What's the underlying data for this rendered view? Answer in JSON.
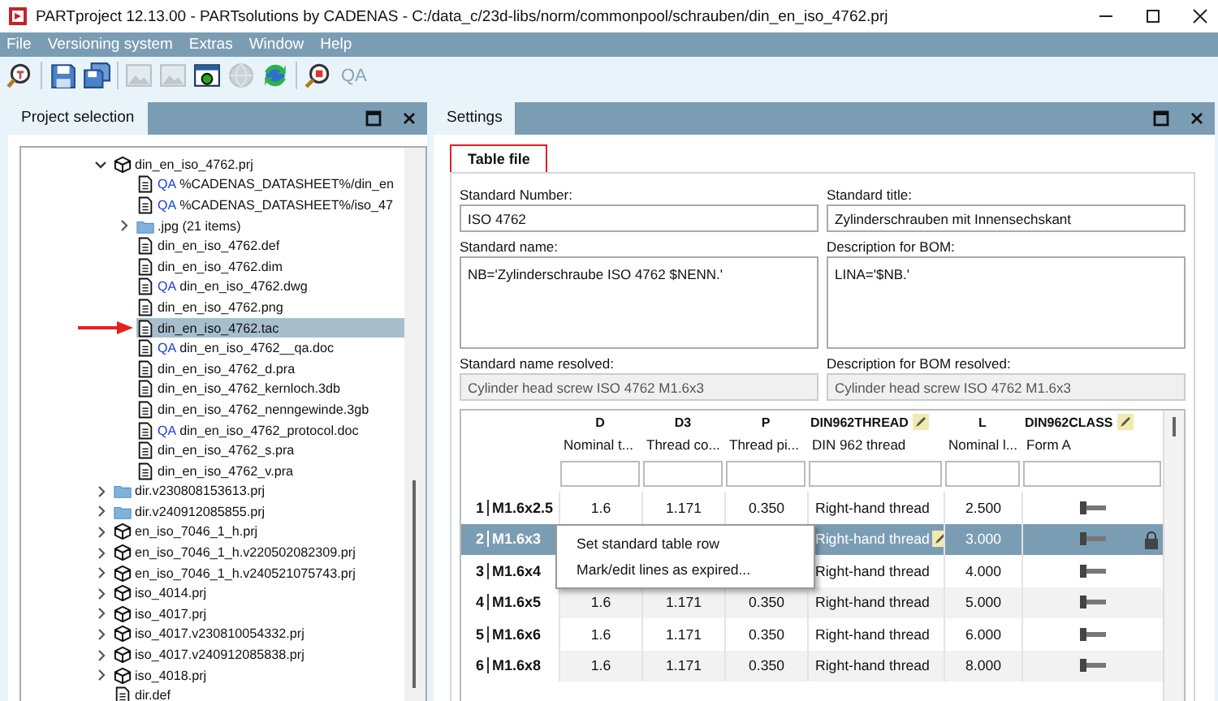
{
  "window": {
    "title": "PARTproject 12.13.00 - PARTsolutions by CADENAS - C:/data_c/23d-libs/norm/commonpool/schrauben/din_en_iso_4762.prj"
  },
  "menu": [
    "File",
    "Versioning system",
    "Extras",
    "Window",
    "Help"
  ],
  "toolbar": [
    {
      "kind": "find",
      "disabled": false
    },
    {
      "kind": "separator"
    },
    {
      "kind": "save",
      "disabled": false
    },
    {
      "kind": "save-all",
      "disabled": false
    },
    {
      "kind": "separator"
    },
    {
      "kind": "image",
      "disabled": true
    },
    {
      "kind": "image",
      "disabled": true
    },
    {
      "kind": "window",
      "disabled": false
    },
    {
      "kind": "globe",
      "disabled": true
    },
    {
      "kind": "sync",
      "disabled": false
    },
    {
      "kind": "separator"
    },
    {
      "kind": "find-red",
      "disabled": false
    },
    {
      "kind": "text",
      "label": "QA",
      "disabled": true
    }
  ],
  "project_panel": {
    "title": "Project selection",
    "tree": [
      {
        "label": "din_en_iso_4762.prj",
        "kind": "part",
        "expanded": true,
        "selected": false,
        "children": [
          {
            "label": "%CADENAS_DATASHEET%/din_en",
            "kind": "file",
            "badge": "QA",
            "selected": false
          },
          {
            "label": "%CADENAS_DATASHEET%/iso_47",
            "kind": "file",
            "badge": "QA",
            "selected": false
          },
          {
            "label": ".jpg (21 items)",
            "kind": "folder",
            "expanded": false,
            "selected": false
          },
          {
            "label": "din_en_iso_4762.def",
            "kind": "file",
            "selected": false
          },
          {
            "label": "din_en_iso_4762.dim",
            "kind": "file",
            "selected": false
          },
          {
            "label": "din_en_iso_4762.dwg",
            "kind": "file",
            "badge": "QA",
            "selected": false
          },
          {
            "label": "din_en_iso_4762.png",
            "kind": "file",
            "selected": false
          },
          {
            "label": "din_en_iso_4762.tac",
            "kind": "file",
            "selected": true,
            "pointed": true
          },
          {
            "label": "din_en_iso_4762__qa.doc",
            "kind": "file",
            "badge": "QA",
            "selected": false
          },
          {
            "label": "din_en_iso_4762_d.pra",
            "kind": "file",
            "selected": false
          },
          {
            "label": "din_en_iso_4762_kernloch.3db",
            "kind": "file",
            "selected": false
          },
          {
            "label": "din_en_iso_4762_nenngewinde.3gb",
            "kind": "file",
            "selected": false
          },
          {
            "label": "din_en_iso_4762_protocol.doc",
            "kind": "file",
            "badge": "QA",
            "selected": false
          },
          {
            "label": "din_en_iso_4762_s.pra",
            "kind": "file",
            "selected": false
          },
          {
            "label": "din_en_iso_4762_v.pra",
            "kind": "file",
            "selected": false
          }
        ]
      },
      {
        "label": "dir.v230808153613.prj",
        "kind": "folder",
        "expanded": false,
        "selected": false
      },
      {
        "label": "dir.v240912085855.prj",
        "kind": "folder",
        "expanded": false,
        "selected": false
      },
      {
        "label": "en_iso_7046_1_h.prj",
        "kind": "part",
        "expanded": false,
        "selected": false
      },
      {
        "label": "en_iso_7046_1_h.v220502082309.prj",
        "kind": "part",
        "expanded": false,
        "selected": false
      },
      {
        "label": "en_iso_7046_1_h.v240521075743.prj",
        "kind": "part",
        "expanded": false,
        "selected": false
      },
      {
        "label": "iso_4014.prj",
        "kind": "part",
        "expanded": false,
        "selected": false
      },
      {
        "label": "iso_4017.prj",
        "kind": "part",
        "expanded": false,
        "selected": false
      },
      {
        "label": "iso_4017.v230810054332.prj",
        "kind": "part",
        "expanded": false,
        "selected": false
      },
      {
        "label": "iso_4017.v240912085838.prj",
        "kind": "part",
        "expanded": false,
        "selected": false
      },
      {
        "label": "iso_4018.prj",
        "kind": "part",
        "expanded": false,
        "selected": false
      },
      {
        "label": "dir.def",
        "kind": "file",
        "selected": false
      }
    ]
  },
  "settings_panel": {
    "title": "Settings",
    "tabs": [
      {
        "label": "Table file",
        "selected": true,
        "highlighted": true
      }
    ],
    "fields": [
      {
        "label": "Standard Number:",
        "value": "ISO 4762",
        "kind": "input",
        "disabled": false
      },
      {
        "label": "Standard title:",
        "value": "Zylinderschrauben mit Innensechskant",
        "kind": "input",
        "disabled": false
      },
      {
        "label": "Standard name:",
        "value": "NB='Zylinderschraube ISO 4762 $NENN.'",
        "kind": "textarea",
        "disabled": false
      },
      {
        "label": "Description for BOM:",
        "value": "LINA='$NB.'",
        "kind": "textarea",
        "disabled": false
      },
      {
        "label": "Standard name resolved:",
        "value": "Cylinder head screw ISO 4762 M1.6x3",
        "kind": "input",
        "disabled": true
      },
      {
        "label": "Description for BOM resolved:",
        "value": "Cylinder head screw ISO 4762 M1.6x3",
        "kind": "input",
        "disabled": true
      }
    ],
    "table": {
      "columns": [
        {
          "name": "D",
          "description": "Nominal t...",
          "kind": "number",
          "editable": false
        },
        {
          "name": "D3",
          "description": "Thread co...",
          "kind": "number",
          "editable": false
        },
        {
          "name": "P",
          "description": "Thread pi...",
          "kind": "number",
          "editable": false
        },
        {
          "name": "DIN962THREAD",
          "description": "DIN 962 thread",
          "kind": "text",
          "editable": true
        },
        {
          "name": "L",
          "description": "Nominal l...",
          "kind": "number",
          "editable": false
        },
        {
          "name": "DIN962CLASS",
          "description": "Form A",
          "kind": "image",
          "editable": true
        }
      ],
      "rows": [
        {
          "index": "1",
          "name": "M1.6x2.5",
          "cells": [
            "1.6",
            "1.171",
            "0.350",
            "Right-hand thread",
            "2.500",
            null
          ],
          "selected": false,
          "locked": false
        },
        {
          "index": "2",
          "name": "M1.6x3",
          "cells": [
            null,
            null,
            null,
            "Right-hand thread",
            "3.000",
            null
          ],
          "selected": true,
          "locked": true
        },
        {
          "index": "3",
          "name": "M1.6x4",
          "cells": [
            null,
            null,
            null,
            "Right-hand thread",
            "4.000",
            null
          ],
          "selected": false,
          "locked": false
        },
        {
          "index": "4",
          "name": "M1.6x5",
          "cells": [
            "1.6",
            "1.171",
            "0.350",
            "Right-hand thread",
            "5.000",
            null
          ],
          "selected": false,
          "locked": false
        },
        {
          "index": "5",
          "name": "M1.6x6",
          "cells": [
            "1.6",
            "1.171",
            "0.350",
            "Right-hand thread",
            "6.000",
            null
          ],
          "selected": false,
          "locked": false
        },
        {
          "index": "6",
          "name": "M1.6x8",
          "cells": [
            "1.6",
            "1.171",
            "0.350",
            "Right-hand thread",
            "8.000",
            null
          ],
          "selected": false,
          "locked": false
        }
      ]
    },
    "context_menu": [
      "Set standard table row",
      "Mark/edit lines as expired..."
    ]
  }
}
